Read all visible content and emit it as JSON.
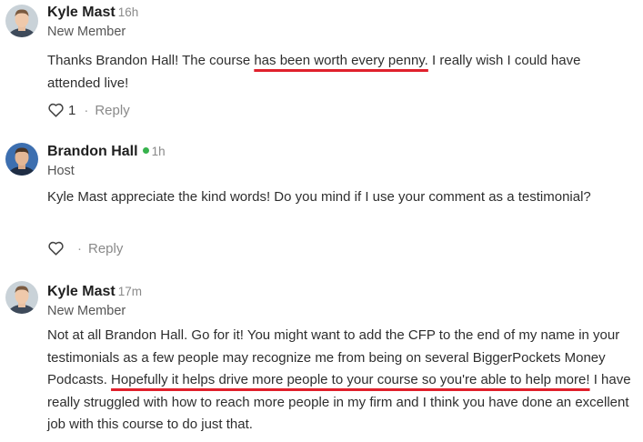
{
  "colors": {
    "underline": "#e0202c",
    "online": "#37b24d"
  },
  "comments": [
    {
      "author": "Kyle Mast",
      "time": "16h",
      "role": "New Member",
      "text_before": "Thanks Brandon Hall! The course ",
      "text_highlight": "has been worth every penny.",
      "text_after": " I really wish I could have attended live!",
      "likes": "1",
      "reply_label": "Reply",
      "separator": "·",
      "avatar_icon": "user-avatar-icon",
      "heart_icon": "heart-outline-icon"
    },
    {
      "author": "Brandon Hall",
      "online": true,
      "time": "1h",
      "role": "Host",
      "text": "Kyle Mast appreciate the kind words! Do you mind if I use your comment as a testimonial?",
      "reply_label": "Reply",
      "separator": "·",
      "avatar_icon": "user-avatar-icon",
      "heart_icon": "heart-outline-icon"
    },
    {
      "author": "Kyle Mast",
      "time": "17m",
      "role": "New Member",
      "text_before": "Not at all Brandon Hall.  Go for it!  You might want to add the CFP to the end of my name in your testimonials as a few people may recognize me from being on several BiggerPockets Money Podcasts. ",
      "text_highlight": "Hopefully it helps drive more people to your course so you're able to help more!",
      "text_after": "  I have really struggled with how to reach more people in my firm and I think you have done an excellent job with this course to do just that.",
      "avatar_icon": "user-avatar-icon"
    }
  ]
}
